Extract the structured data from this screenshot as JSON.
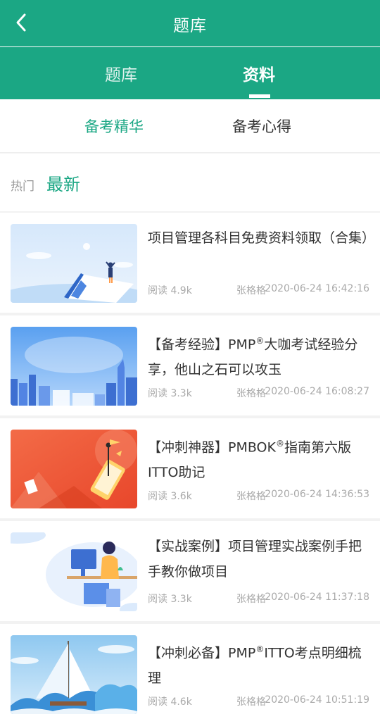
{
  "header": {
    "title": "题库"
  },
  "tabs": [
    {
      "label": "题库",
      "active": false
    },
    {
      "label": "资料",
      "active": true
    }
  ],
  "subtabs": [
    {
      "label": "备考精华",
      "active": true
    },
    {
      "label": "备考心得",
      "active": false
    }
  ],
  "filters": {
    "hot": "热门",
    "new": "最新"
  },
  "colors": {
    "brand": "#1ba784",
    "meta": "#aaaaaa"
  },
  "articles": [
    {
      "title": "项目管理各科目免费资料领取（合集）",
      "title_pre": "项目管理各科目免费资料领取（合集）",
      "title_sup": "",
      "title_post": "",
      "reads": "阅读 4.9k",
      "author": "张格格",
      "date": "2020-06-24 16:42:16"
    },
    {
      "title_pre": "【备考经验】PMP",
      "title_sup": "®",
      "title_post": "大咖考试经验分享，他山之石可以攻玉",
      "reads": "阅读 3.3k",
      "author": "张格格",
      "date": "2020-06-24 16:08:27"
    },
    {
      "title_pre": "【冲刺神器】PMBOK",
      "title_sup": "®",
      "title_post": "指南第六版ITTO助记",
      "reads": "阅读 3.6k",
      "author": "张格格",
      "date": "2020-06-24 14:36:53"
    },
    {
      "title_pre": "【实战案例】项目管理实战案例手把手教你做项目",
      "title_sup": "",
      "title_post": "",
      "reads": "阅读 3.3k",
      "author": "张格格",
      "date": "2020-06-24 11:37:18"
    },
    {
      "title_pre": "【冲刺必备】PMP",
      "title_sup": "®",
      "title_post": "ITTO考点明细梳理",
      "reads": "阅读 4.6k",
      "author": "张格格",
      "date": "2020-06-24 10:51:19"
    }
  ]
}
